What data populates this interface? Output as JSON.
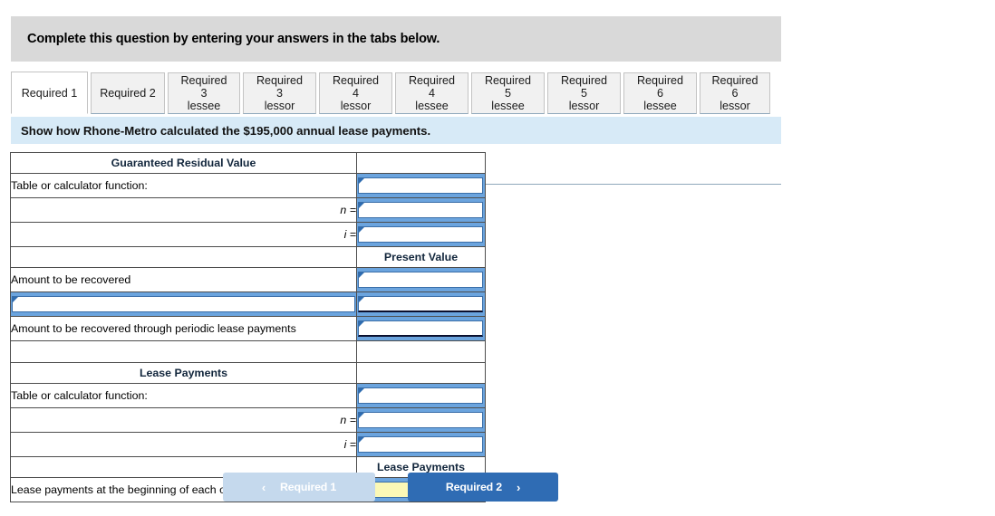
{
  "banner": {
    "text": "Complete this question by entering your answers in the tabs below."
  },
  "tabs": [
    {
      "label": "Required 1",
      "active": true
    },
    {
      "label": "Required 2",
      "active": false
    },
    {
      "label": "Required 3\nlessee",
      "active": false
    },
    {
      "label": "Required 3\nlessor",
      "active": false
    },
    {
      "label": "Required 4\nlessor",
      "active": false
    },
    {
      "label": "Required 4\nlessee",
      "active": false
    },
    {
      "label": "Required 5\nlessee",
      "active": false
    },
    {
      "label": "Required 5\nlessor",
      "active": false
    },
    {
      "label": "Required 6\nlessee",
      "active": false
    },
    {
      "label": "Required 6\nlessor",
      "active": false
    }
  ],
  "question": {
    "text": "Show how Rhone-Metro calculated the $195,000 annual lease payments."
  },
  "worksheet": {
    "section1_title": "Guaranteed Residual Value",
    "row_table_function": "Table or calculator function:",
    "row_n": "n =",
    "row_i": "i =",
    "present_value_header": "Present Value",
    "row_amount_recovered": "Amount to be recovered",
    "row_amount_recovered_periodic": "Amount to be recovered through periodic lease payments",
    "section2_title": "Lease Payments",
    "lease_payments_header": "Lease Payments",
    "row_lease_payments": "Lease payments at the beginning of each of the next four years",
    "field_values": {
      "grv_function": "",
      "grv_n": "",
      "grv_i": "",
      "amount_recovered": "",
      "blank_left": "",
      "blank_right": "",
      "amount_periodic": "",
      "lp_function": "",
      "lp_n": "",
      "lp_i": "",
      "lease_payment_amount": ""
    }
  },
  "nav": {
    "prev_label": "Required 1",
    "prev_icon": "chevron-left-icon",
    "next_label": "Required 2",
    "next_icon": "chevron-right-icon"
  },
  "colors": {
    "banner_gray": "#d9d9d9",
    "question_blue": "#d7eaf7",
    "header_blue": "#6ba4de",
    "field_border": "#3a6ea8",
    "highlight_yellow": "#fbf8b6",
    "btn_primary": "#2f6cb4",
    "btn_disabled": "#c5d9ed"
  }
}
